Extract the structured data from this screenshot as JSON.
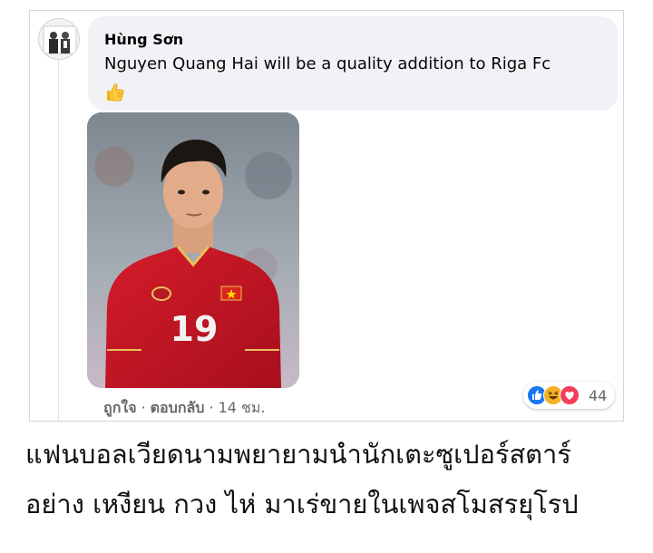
{
  "comment": {
    "author": "Hùng Sơn",
    "text": "Nguyen Quang Hai will be a quality addition to Riga Fc",
    "emoji": "thumbs-up-emoji",
    "actions": {
      "like": "ถูกใจ",
      "separator": "·",
      "reply": "ตอบกลับ",
      "time": "14 ชม."
    },
    "reactions": {
      "icons": [
        "like-reaction-icon",
        "haha-reaction-icon",
        "love-reaction-icon"
      ],
      "count": "44"
    },
    "photo": {
      "jersey_number": "19"
    }
  },
  "caption": {
    "line1": "แฟนบอลเวียดนามพยายามนำนักเตะซูเปอร์สตาร์",
    "line2": "อย่าง เหงียน กวง ไห่ มาเร่ขายในเพจสโมสรยุโรป"
  },
  "colors": {
    "bubble": "#f0f2f5",
    "secondary_text": "#65676b",
    "like_blue": "#1877f2",
    "love_red": "#f33e58",
    "haha_yellow": "#f7b125",
    "jersey_red": "#c8102e"
  }
}
